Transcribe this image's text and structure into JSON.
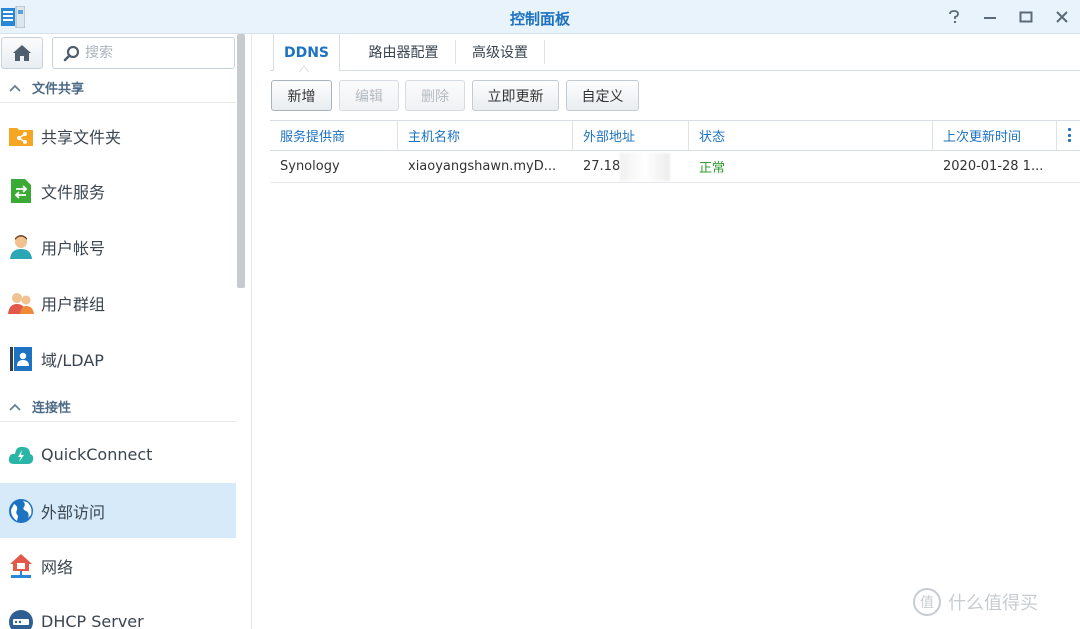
{
  "window": {
    "title": "控制面板",
    "controls": [
      "help-icon",
      "minimize-icon",
      "maximize-icon",
      "close-icon"
    ]
  },
  "sidebar": {
    "search_placeholder": "搜索",
    "sections": [
      {
        "label": "文件共享",
        "items": [
          {
            "label": "共享文件夹",
            "icon": "shared-folder-icon",
            "active": false
          },
          {
            "label": "文件服务",
            "icon": "file-services-icon",
            "active": false
          },
          {
            "label": "用户帐号",
            "icon": "user-icon",
            "active": false
          },
          {
            "label": "用户群组",
            "icon": "group-icon",
            "active": false
          },
          {
            "label": "域/LDAP",
            "icon": "ldap-icon",
            "active": false
          }
        ]
      },
      {
        "label": "连接性",
        "items": [
          {
            "label": "QuickConnect",
            "icon": "quickconnect-icon",
            "active": false
          },
          {
            "label": "外部访问",
            "icon": "globe-icon",
            "active": true
          },
          {
            "label": "网络",
            "icon": "network-icon",
            "active": false
          },
          {
            "label": "DHCP Server",
            "icon": "dhcp-icon",
            "active": false
          }
        ]
      }
    ]
  },
  "tabs": [
    {
      "label": "DDNS",
      "active": true
    },
    {
      "label": "路由器配置",
      "active": false
    },
    {
      "label": "高级设置",
      "active": false
    }
  ],
  "toolbar": {
    "add": "新增",
    "edit": "编辑",
    "delete": "删除",
    "update_now": "立即更新",
    "customize": "自定义"
  },
  "grid": {
    "columns": [
      "服务提供商",
      "主机名称",
      "外部地址",
      "状态",
      "上次更新时间"
    ],
    "rows": [
      [
        "Synology",
        "xiaoyangshawn.myD...",
        "27.18",
        "正常",
        "2020-01-28 1..."
      ]
    ]
  },
  "watermark": "什么值得买",
  "colors": {
    "accent": "#1d72c1",
    "active_nav_bg": "#d6eaf9",
    "status_ok": "#2e9c2e",
    "titlebar_bg": "#e9f3fb"
  }
}
